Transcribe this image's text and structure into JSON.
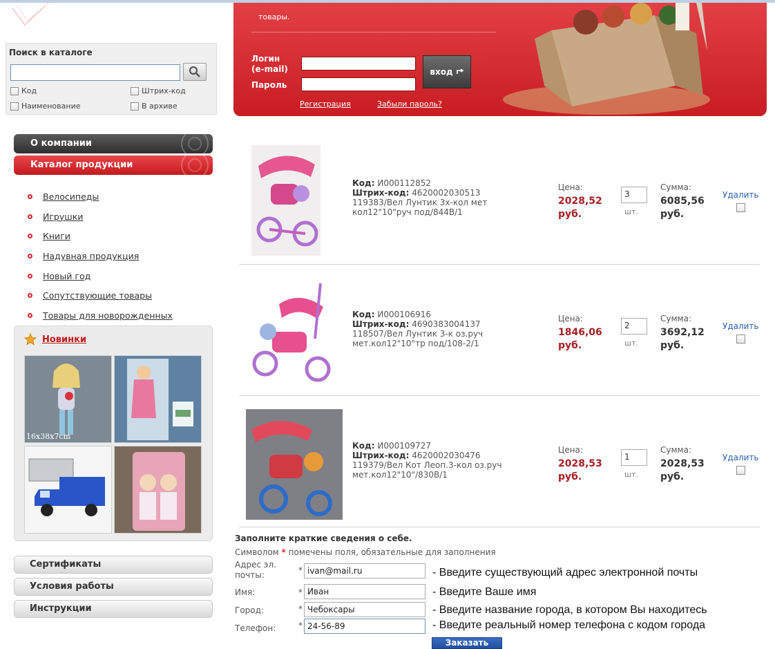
{
  "search": {
    "title": "Поиск в каталоге",
    "input_value": "",
    "checkboxes": [
      "Код",
      "Штрих-код",
      "Наименование",
      "В архиве"
    ]
  },
  "menu": {
    "about": "О компании",
    "catalog": "Каталог продукции"
  },
  "categories": [
    "Велосипеды",
    "Игрушки",
    "Книги",
    "Надувная продукция",
    "Новый год",
    "Сопутствующие товары",
    "Товары для новорожденных"
  ],
  "news": {
    "title": "Новинки",
    "thumb1_caption": "16x38x7cm"
  },
  "bottom_menu": [
    "Сертификаты",
    "Условия работы",
    "Инструкции"
  ],
  "banner": {
    "text": "товары.",
    "login_label": "Логин (e-mail)",
    "password_label": "Пароль",
    "enter_label": "вход",
    "register_link": "Регистрация",
    "forgot_link": "Забыли пароль?"
  },
  "cart": {
    "code_label": "Код:",
    "barcode_label": "Штрих-код:",
    "price_label": "Цена:",
    "sum_label": "Сумма:",
    "unit": "шт.",
    "delete_label": "Удалить",
    "items": [
      {
        "code": "И000112852",
        "barcode": "4620002030513",
        "name": "119383/Вел Лунтик 3х-кол мет кол12\"10\"руч под/844B/1",
        "price": "2028,52 руб.",
        "qty": "3",
        "sum": "6085,56 руб."
      },
      {
        "code": "И000106916",
        "barcode": "4690383004137",
        "name": "118507/Вел Лунтик 3-к оз.руч мет.кол12\"10\"тр под/108-2/1",
        "price": "1846,06 руб.",
        "qty": "2",
        "sum": "3692,12 руб."
      },
      {
        "code": "И000109727",
        "barcode": "4620002030476",
        "name": "119379/Вел Кот Леоп.3-кол оз.руч мет.кол12\"10\"/830B/1",
        "price": "2028,53 руб.",
        "qty": "1",
        "sum": "2028,53 руб."
      }
    ]
  },
  "form": {
    "title": "Заполните краткие сведения о себе.",
    "note_prefix": "Символом",
    "note_star": "*",
    "note_suffix": "помечены поля, обязательные для заполнения",
    "fields": [
      {
        "label": "Адрес эл. почты:",
        "value": "ivan@mail.ru",
        "hint": "- Введите существующий адрес электронной почты"
      },
      {
        "label": "Имя:",
        "value": "Иван",
        "hint": "- Введите Ваше имя"
      },
      {
        "label": "Город:",
        "value": "Чебоксары",
        "hint": "- Введите название города, в котором Вы находитесь"
      },
      {
        "label": "Телефон:",
        "value": "24-56-89",
        "hint": "- Введите реальный номер телефона с кодом города"
      }
    ],
    "required_mark": "*",
    "submit_label": "Заказать"
  }
}
